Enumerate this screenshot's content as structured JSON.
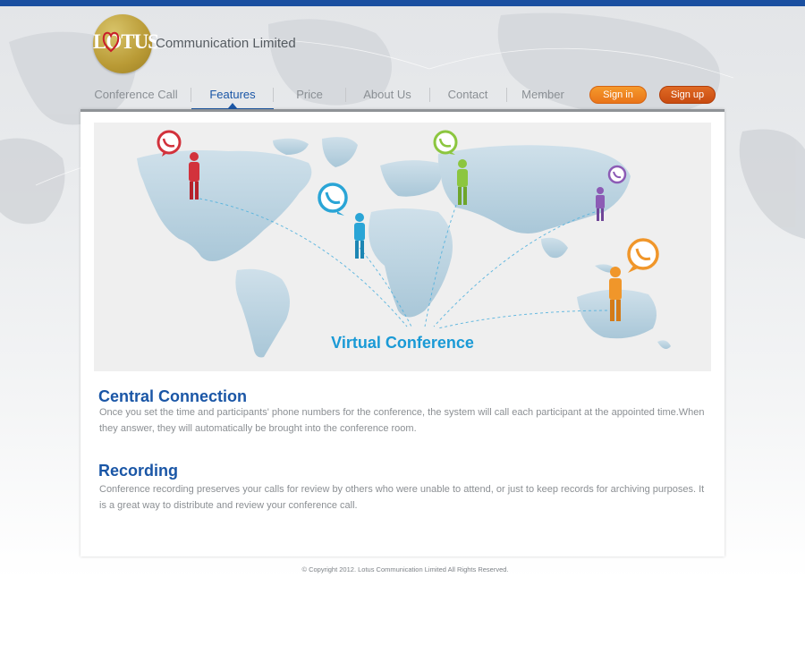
{
  "brand": {
    "logo_text": "LOTUS",
    "company_name": "Communication Limited"
  },
  "nav": {
    "items": [
      {
        "label": "Conference Call"
      },
      {
        "label": "Features",
        "active": true
      },
      {
        "label": "Price"
      },
      {
        "label": "About Us"
      },
      {
        "label": "Contact"
      },
      {
        "label": "Member"
      }
    ],
    "signin_label": "Sign in",
    "signup_label": "Sign up"
  },
  "banner": {
    "title": "Virtual Conference",
    "participant_colors": [
      "#d2323c",
      "#2aa5d6",
      "#8cc63f",
      "#8c5bb5",
      "#f0962a"
    ]
  },
  "sections": [
    {
      "heading": "Central Connection",
      "body": "Once you set the time and participants' phone numbers for the conference, the system will call each participant at the appointed time.When they answer, they will automatically be brought into the conference room."
    },
    {
      "heading": "Recording",
      "body": "Conference recording preserves your calls for review by others who were unable to attend, or just to keep records for archiving purposes. It is a great way to distribute and review your conference call."
    }
  ],
  "footer": {
    "copyright": "© Copyright 2012. Lotus Communication Limited All Rights Reserved."
  },
  "colors": {
    "accent_blue": "#1a56a6",
    "brand_gold": "#b99a35",
    "signin_orange": "#f0882a",
    "signup_orange": "#d5581a"
  }
}
